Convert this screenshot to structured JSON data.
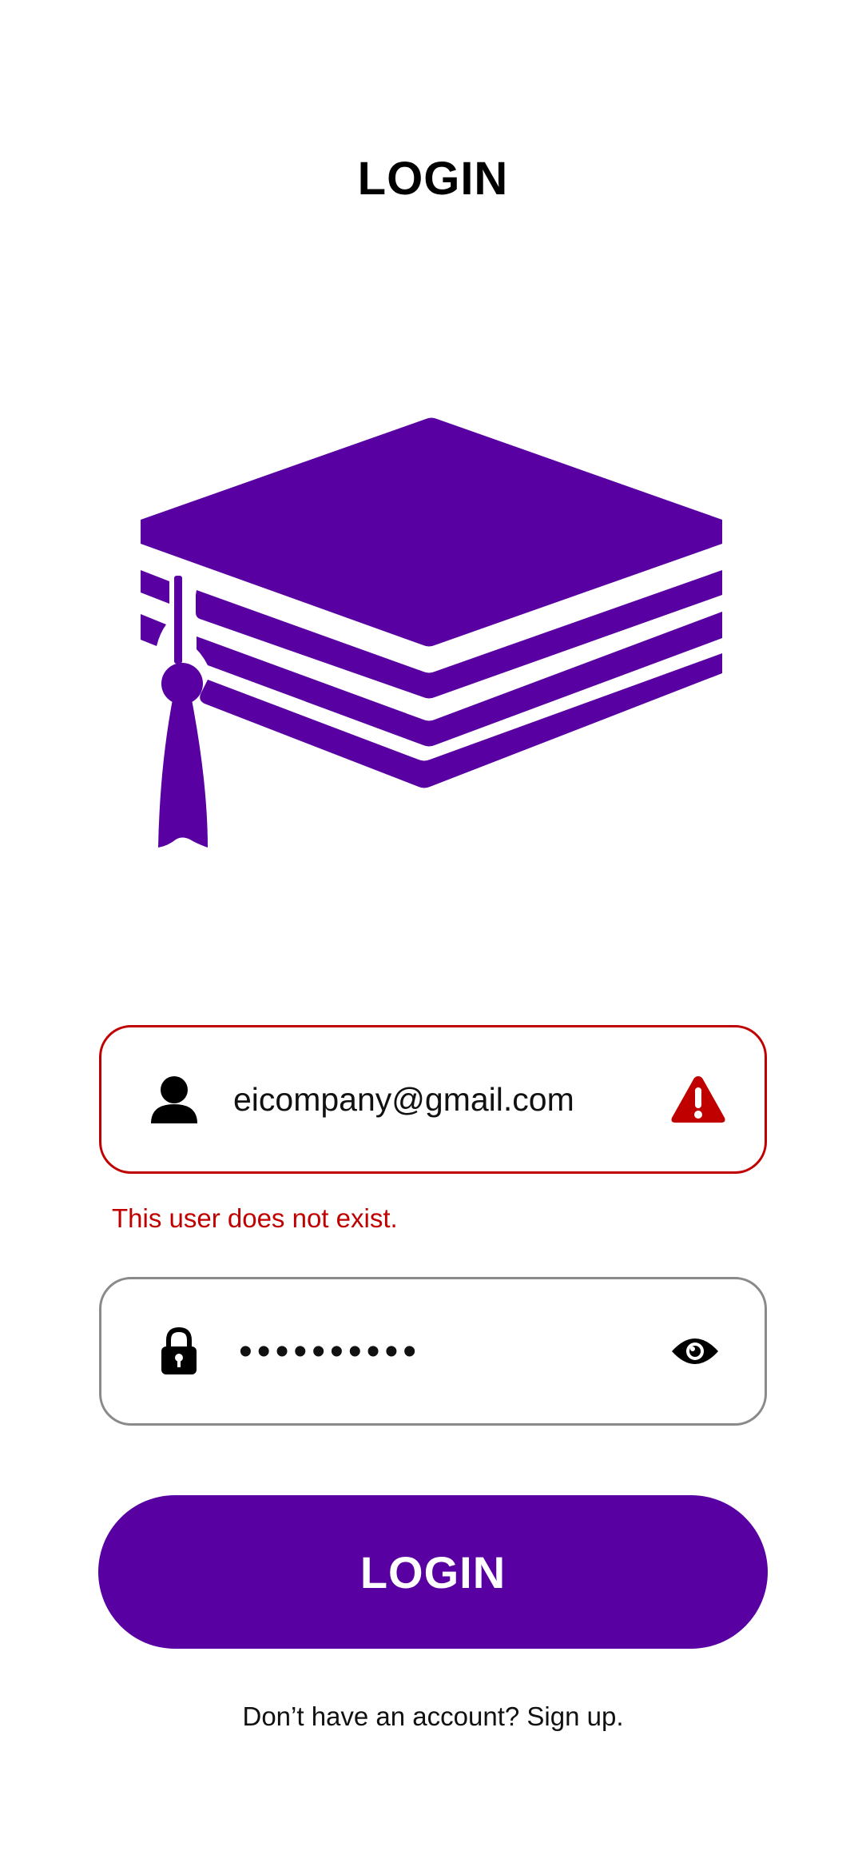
{
  "header": {
    "title": "LOGIN"
  },
  "logo": {
    "icon": "graduation-cap-icon",
    "color": "#5900a3"
  },
  "email_field": {
    "icon": "user-icon",
    "value": "eicompany@gmail.com",
    "status_icon": "warning-icon",
    "error_color": "#c00000"
  },
  "error": {
    "message": "This user does not exist."
  },
  "password_field": {
    "icon": "lock-icon",
    "value": "••••••••••",
    "toggle_icon": "eye-icon"
  },
  "login_button": {
    "label": "LOGIN",
    "color": "#5900a3"
  },
  "signup": {
    "text": "Don’t have an account? Sign up."
  }
}
